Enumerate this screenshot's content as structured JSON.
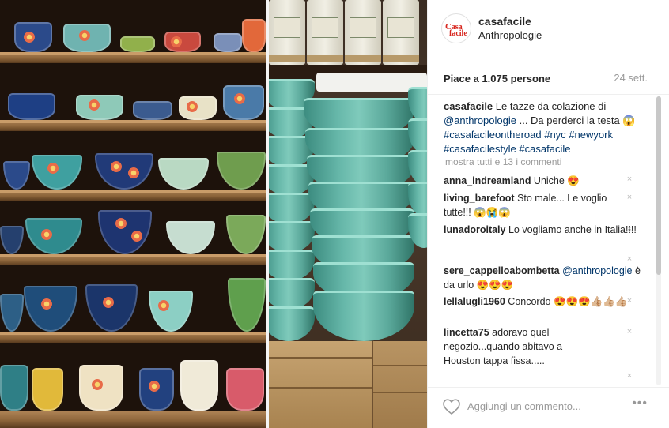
{
  "header": {
    "logo_top": "Casa",
    "logo_bottom": "facile",
    "username": "casafacile",
    "location": "Anthropologie"
  },
  "stats": {
    "likes": "Piace a 1.075 persone",
    "time": "24 sett."
  },
  "caption": {
    "user": "casafacile",
    "text": " Le tazze da colazione di ",
    "mention": "@anthropologie",
    "text2": " ... Da perderci la testa ",
    "emoji": "😱",
    "hashtags1": "#casafacileontheroad",
    "hashtags2": "#nyc",
    "hashtags3": "#newyork",
    "hashtags4": "#casafacilestyle",
    "hashtags5": "#casafacile"
  },
  "more_comments": "mostra tutti e 13 i commenti",
  "comments": [
    {
      "user": "anna_indreamland",
      "text": " Uniche 😍"
    },
    {
      "user": "living_barefoot",
      "text": " Sto male... Le voglio tutte!!! 😱😭😱"
    },
    {
      "user": "lunadoroitaly",
      "text": " Lo vogliamo anche in Italia!!!!"
    },
    {
      "user": "sere_cappelloabombetta",
      "mention": " @anthropologie",
      "text": " è da urlo 😍😍😍"
    },
    {
      "user": "lellalugli1960",
      "text": " Concordo 😍😍😍👍🏼👍🏼👍🏼"
    },
    {
      "user": "lincetta75",
      "text": " adoravo quel negozio...quando abitavo a Houston tappa fissa....."
    }
  ],
  "composer": {
    "placeholder": "Aggiungi un commento...",
    "options": "•••",
    "remove_glyph": "×"
  },
  "icons": {
    "like": "heart-outline-icon",
    "remove": "close-icon",
    "more": "more-options-icon"
  },
  "colors": {
    "link": "#003569",
    "muted": "#999999",
    "brand_red": "#d7261e"
  }
}
